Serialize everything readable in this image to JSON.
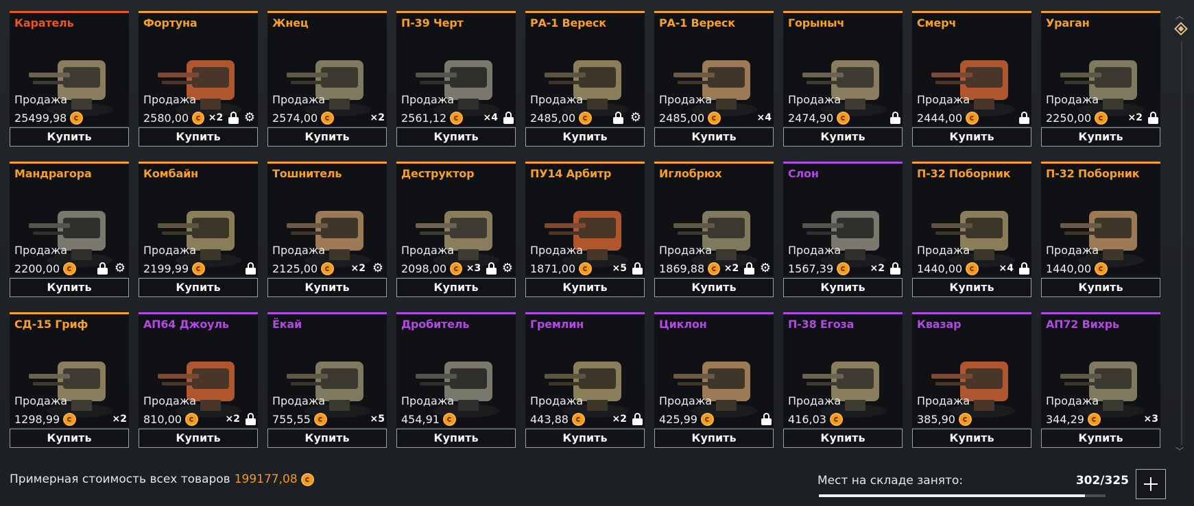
{
  "colors": {
    "orange": "#f5a02a",
    "purple": "#b04be0",
    "red": "#e8571f",
    "coin": "#f59a1c"
  },
  "ui": {
    "sale_label": "Продажа",
    "buy_label": "Купить"
  },
  "items": [
    {
      "name": "Каратель",
      "rarity": "red",
      "price": "25499,98",
      "mult": "",
      "lock": false,
      "gear": false
    },
    {
      "name": "Фортуна",
      "rarity": "orange",
      "price": "2580,00",
      "mult": "×2",
      "lock": true,
      "gear": true
    },
    {
      "name": "Жнец",
      "rarity": "orange",
      "price": "2574,00",
      "mult": "×2",
      "lock": false,
      "gear": false
    },
    {
      "name": "П-39 Черт",
      "rarity": "orange",
      "price": "2561,12",
      "mult": "×4",
      "lock": true,
      "gear": false
    },
    {
      "name": "РА-1 Вереск",
      "rarity": "orange",
      "price": "2485,00",
      "mult": "",
      "lock": true,
      "gear": true
    },
    {
      "name": "РА-1 Вереск",
      "rarity": "orange",
      "price": "2485,00",
      "mult": "×4",
      "lock": false,
      "gear": false
    },
    {
      "name": "Горыныч",
      "rarity": "orange",
      "price": "2474,90",
      "mult": "",
      "lock": true,
      "gear": false
    },
    {
      "name": "Смерч",
      "rarity": "orange",
      "price": "2444,00",
      "mult": "",
      "lock": true,
      "gear": false
    },
    {
      "name": "Ураган",
      "rarity": "orange",
      "price": "2250,00",
      "mult": "×2",
      "lock": true,
      "gear": false
    },
    {
      "name": "Мандрагора",
      "rarity": "orange",
      "price": "2200,00",
      "mult": "",
      "lock": true,
      "gear": true
    },
    {
      "name": "Комбайн",
      "rarity": "orange",
      "price": "2199,99",
      "mult": "",
      "lock": true,
      "gear": false
    },
    {
      "name": "Тошнитель",
      "rarity": "orange",
      "price": "2125,00",
      "mult": "×2",
      "lock": false,
      "gear": true
    },
    {
      "name": "Деструктор",
      "rarity": "orange",
      "price": "2098,00",
      "mult": "×3",
      "lock": true,
      "gear": true
    },
    {
      "name": "ПУ14 Арбитр",
      "rarity": "orange",
      "price": "1871,00",
      "mult": "×5",
      "lock": true,
      "gear": false
    },
    {
      "name": "Иглобрюх",
      "rarity": "orange",
      "price": "1869,88",
      "mult": "×2",
      "lock": true,
      "gear": true
    },
    {
      "name": "Слон",
      "rarity": "purple",
      "price": "1567,39",
      "mult": "×2",
      "lock": true,
      "gear": false
    },
    {
      "name": "П-32 Поборник",
      "rarity": "orange",
      "price": "1440,00",
      "mult": "×4",
      "lock": true,
      "gear": false
    },
    {
      "name": "П-32 Поборник",
      "rarity": "orange",
      "price": "1440,00",
      "mult": "",
      "lock": false,
      "gear": false
    },
    {
      "name": "СД-15 Гриф",
      "rarity": "orange",
      "price": "1298,99",
      "mult": "×2",
      "lock": false,
      "gear": false
    },
    {
      "name": "АП64 Джоуль",
      "rarity": "purple",
      "price": "810,00",
      "mult": "×2",
      "lock": true,
      "gear": false
    },
    {
      "name": "Ёкай",
      "rarity": "purple",
      "price": "755,55",
      "mult": "×5",
      "lock": false,
      "gear": false
    },
    {
      "name": "Дробитель",
      "rarity": "purple",
      "price": "454,91",
      "mult": "",
      "lock": false,
      "gear": false
    },
    {
      "name": "Гремлин",
      "rarity": "purple",
      "price": "443,88",
      "mult": "×2",
      "lock": true,
      "gear": false
    },
    {
      "name": "Циклон",
      "rarity": "purple",
      "price": "425,99",
      "mult": "",
      "lock": true,
      "gear": false
    },
    {
      "name": "П-38 Егоза",
      "rarity": "purple",
      "price": "416,03",
      "mult": "",
      "lock": false,
      "gear": false
    },
    {
      "name": "Квазар",
      "rarity": "purple",
      "price": "385,90",
      "mult": "",
      "lock": false,
      "gear": false
    },
    {
      "name": "АП72 Вихрь",
      "rarity": "purple",
      "price": "344,29",
      "mult": "×3",
      "lock": false,
      "gear": false
    }
  ],
  "footer": {
    "total_label": "Примерная стоимость всех товаров",
    "total_value": "199177,08",
    "storage_label": "Мест на складе занято:",
    "storage_count": "302/325",
    "storage_fraction": 0.929
  }
}
